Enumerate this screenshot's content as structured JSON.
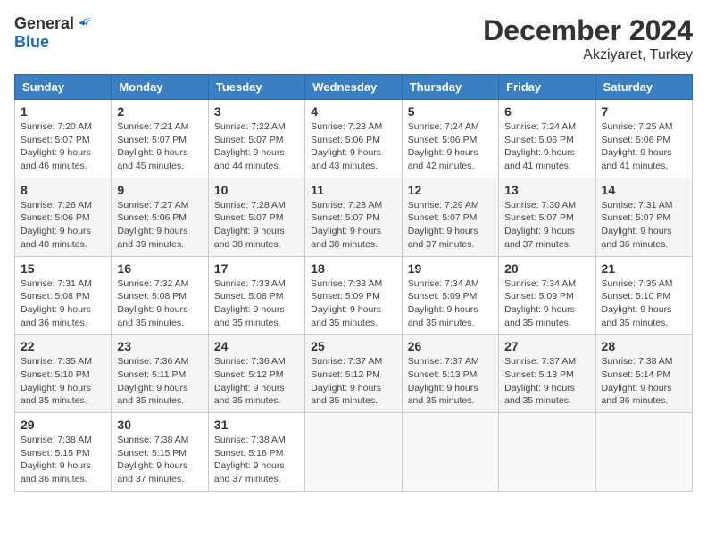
{
  "header": {
    "logo_general": "General",
    "logo_blue": "Blue",
    "month_title": "December 2024",
    "location": "Akziyaret, Turkey"
  },
  "calendar": {
    "days_of_week": [
      "Sunday",
      "Monday",
      "Tuesday",
      "Wednesday",
      "Thursday",
      "Friday",
      "Saturday"
    ],
    "weeks": [
      [
        {
          "day": "1",
          "sunrise": "Sunrise: 7:20 AM",
          "sunset": "Sunset: 5:07 PM",
          "daylight": "Daylight: 9 hours and 46 minutes."
        },
        {
          "day": "2",
          "sunrise": "Sunrise: 7:21 AM",
          "sunset": "Sunset: 5:07 PM",
          "daylight": "Daylight: 9 hours and 45 minutes."
        },
        {
          "day": "3",
          "sunrise": "Sunrise: 7:22 AM",
          "sunset": "Sunset: 5:07 PM",
          "daylight": "Daylight: 9 hours and 44 minutes."
        },
        {
          "day": "4",
          "sunrise": "Sunrise: 7:23 AM",
          "sunset": "Sunset: 5:06 PM",
          "daylight": "Daylight: 9 hours and 43 minutes."
        },
        {
          "day": "5",
          "sunrise": "Sunrise: 7:24 AM",
          "sunset": "Sunset: 5:06 PM",
          "daylight": "Daylight: 9 hours and 42 minutes."
        },
        {
          "day": "6",
          "sunrise": "Sunrise: 7:24 AM",
          "sunset": "Sunset: 5:06 PM",
          "daylight": "Daylight: 9 hours and 41 minutes."
        },
        {
          "day": "7",
          "sunrise": "Sunrise: 7:25 AM",
          "sunset": "Sunset: 5:06 PM",
          "daylight": "Daylight: 9 hours and 41 minutes."
        }
      ],
      [
        {
          "day": "8",
          "sunrise": "Sunrise: 7:26 AM",
          "sunset": "Sunset: 5:06 PM",
          "daylight": "Daylight: 9 hours and 40 minutes."
        },
        {
          "day": "9",
          "sunrise": "Sunrise: 7:27 AM",
          "sunset": "Sunset: 5:06 PM",
          "daylight": "Daylight: 9 hours and 39 minutes."
        },
        {
          "day": "10",
          "sunrise": "Sunrise: 7:28 AM",
          "sunset": "Sunset: 5:07 PM",
          "daylight": "Daylight: 9 hours and 38 minutes."
        },
        {
          "day": "11",
          "sunrise": "Sunrise: 7:28 AM",
          "sunset": "Sunset: 5:07 PM",
          "daylight": "Daylight: 9 hours and 38 minutes."
        },
        {
          "day": "12",
          "sunrise": "Sunrise: 7:29 AM",
          "sunset": "Sunset: 5:07 PM",
          "daylight": "Daylight: 9 hours and 37 minutes."
        },
        {
          "day": "13",
          "sunrise": "Sunrise: 7:30 AM",
          "sunset": "Sunset: 5:07 PM",
          "daylight": "Daylight: 9 hours and 37 minutes."
        },
        {
          "day": "14",
          "sunrise": "Sunrise: 7:31 AM",
          "sunset": "Sunset: 5:07 PM",
          "daylight": "Daylight: 9 hours and 36 minutes."
        }
      ],
      [
        {
          "day": "15",
          "sunrise": "Sunrise: 7:31 AM",
          "sunset": "Sunset: 5:08 PM",
          "daylight": "Daylight: 9 hours and 36 minutes."
        },
        {
          "day": "16",
          "sunrise": "Sunrise: 7:32 AM",
          "sunset": "Sunset: 5:08 PM",
          "daylight": "Daylight: 9 hours and 35 minutes."
        },
        {
          "day": "17",
          "sunrise": "Sunrise: 7:33 AM",
          "sunset": "Sunset: 5:08 PM",
          "daylight": "Daylight: 9 hours and 35 minutes."
        },
        {
          "day": "18",
          "sunrise": "Sunrise: 7:33 AM",
          "sunset": "Sunset: 5:09 PM",
          "daylight": "Daylight: 9 hours and 35 minutes."
        },
        {
          "day": "19",
          "sunrise": "Sunrise: 7:34 AM",
          "sunset": "Sunset: 5:09 PM",
          "daylight": "Daylight: 9 hours and 35 minutes."
        },
        {
          "day": "20",
          "sunrise": "Sunrise: 7:34 AM",
          "sunset": "Sunset: 5:09 PM",
          "daylight": "Daylight: 9 hours and 35 minutes."
        },
        {
          "day": "21",
          "sunrise": "Sunrise: 7:35 AM",
          "sunset": "Sunset: 5:10 PM",
          "daylight": "Daylight: 9 hours and 35 minutes."
        }
      ],
      [
        {
          "day": "22",
          "sunrise": "Sunrise: 7:35 AM",
          "sunset": "Sunset: 5:10 PM",
          "daylight": "Daylight: 9 hours and 35 minutes."
        },
        {
          "day": "23",
          "sunrise": "Sunrise: 7:36 AM",
          "sunset": "Sunset: 5:11 PM",
          "daylight": "Daylight: 9 hours and 35 minutes."
        },
        {
          "day": "24",
          "sunrise": "Sunrise: 7:36 AM",
          "sunset": "Sunset: 5:12 PM",
          "daylight": "Daylight: 9 hours and 35 minutes."
        },
        {
          "day": "25",
          "sunrise": "Sunrise: 7:37 AM",
          "sunset": "Sunset: 5:12 PM",
          "daylight": "Daylight: 9 hours and 35 minutes."
        },
        {
          "day": "26",
          "sunrise": "Sunrise: 7:37 AM",
          "sunset": "Sunset: 5:13 PM",
          "daylight": "Daylight: 9 hours and 35 minutes."
        },
        {
          "day": "27",
          "sunrise": "Sunrise: 7:37 AM",
          "sunset": "Sunset: 5:13 PM",
          "daylight": "Daylight: 9 hours and 35 minutes."
        },
        {
          "day": "28",
          "sunrise": "Sunrise: 7:38 AM",
          "sunset": "Sunset: 5:14 PM",
          "daylight": "Daylight: 9 hours and 36 minutes."
        }
      ],
      [
        {
          "day": "29",
          "sunrise": "Sunrise: 7:38 AM",
          "sunset": "Sunset: 5:15 PM",
          "daylight": "Daylight: 9 hours and 36 minutes."
        },
        {
          "day": "30",
          "sunrise": "Sunrise: 7:38 AM",
          "sunset": "Sunset: 5:15 PM",
          "daylight": "Daylight: 9 hours and 37 minutes."
        },
        {
          "day": "31",
          "sunrise": "Sunrise: 7:38 AM",
          "sunset": "Sunset: 5:16 PM",
          "daylight": "Daylight: 9 hours and 37 minutes."
        },
        null,
        null,
        null,
        null
      ]
    ]
  }
}
